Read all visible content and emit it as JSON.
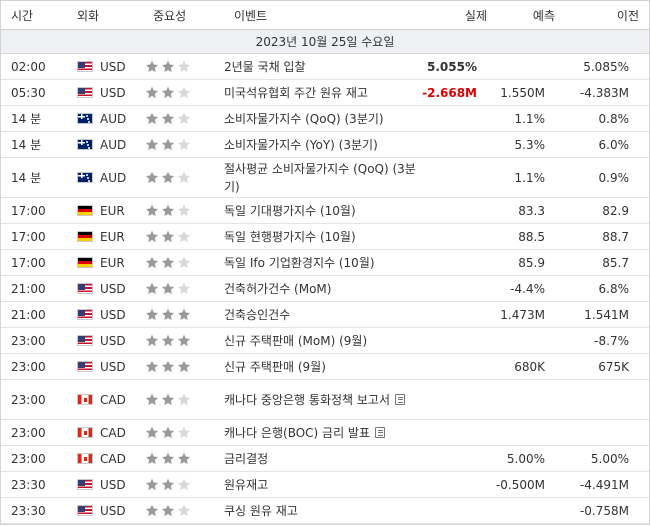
{
  "header": {
    "time": "시간",
    "currency": "외화",
    "importance": "중요성",
    "event": "이벤트",
    "actual": "실제",
    "forecast": "예측",
    "previous": "이전"
  },
  "date_label": "2023년 10월 25일 수요일",
  "colors": {
    "negative": "#e00000",
    "star_on": "#9a9a9a",
    "star_off": "#d9d9d9",
    "date_bg": "#eef0f3"
  },
  "rows": [
    {
      "time": "02:00",
      "flag": "us",
      "currency": "USD",
      "stars": 2,
      "event": "2년물 국채 입찰",
      "doc": false,
      "actual": "5.055%",
      "actual_color": "pos",
      "forecast": "",
      "previous": "5.085%",
      "prev_bold": false,
      "tall": false
    },
    {
      "time": "05:30",
      "flag": "us",
      "currency": "USD",
      "stars": 2,
      "event": "미국석유협회 주간 원유 재고",
      "doc": false,
      "actual": "-2.668M",
      "actual_color": "neg",
      "forecast": "1.550M",
      "previous": "-4.383M",
      "prev_bold": false,
      "tall": false
    },
    {
      "time": "14 분",
      "flag": "au",
      "currency": "AUD",
      "stars": 2,
      "event": "소비자물가지수 (QoQ) (3분기)",
      "doc": false,
      "actual": "",
      "actual_color": "pos",
      "forecast": "1.1%",
      "previous": "0.8%",
      "prev_bold": false,
      "tall": false
    },
    {
      "time": "14 분",
      "flag": "au",
      "currency": "AUD",
      "stars": 2,
      "event": "소비자물가지수 (YoY) (3분기)",
      "doc": false,
      "actual": "",
      "actual_color": "pos",
      "forecast": "5.3%",
      "previous": "6.0%",
      "prev_bold": false,
      "tall": false
    },
    {
      "time": "14 분",
      "flag": "au",
      "currency": "AUD",
      "stars": 2,
      "event": "절사평균 소비자물가지수 (QoQ) (3분기)",
      "doc": false,
      "actual": "",
      "actual_color": "pos",
      "forecast": "1.1%",
      "previous": "0.9%",
      "prev_bold": false,
      "tall": true
    },
    {
      "time": "17:00",
      "flag": "de",
      "currency": "EUR",
      "stars": 2,
      "event": "독일 기대평가지수 (10월)",
      "doc": false,
      "actual": "",
      "actual_color": "pos",
      "forecast": "83.3",
      "previous": "82.9",
      "prev_bold": false,
      "tall": false
    },
    {
      "time": "17:00",
      "flag": "de",
      "currency": "EUR",
      "stars": 2,
      "event": "독일 현행평가지수 (10월)",
      "doc": false,
      "actual": "",
      "actual_color": "pos",
      "forecast": "88.5",
      "previous": "88.7",
      "prev_bold": false,
      "tall": false
    },
    {
      "time": "17:00",
      "flag": "de",
      "currency": "EUR",
      "stars": 2,
      "event": "독일 Ifo 기업환경지수 (10월)",
      "doc": false,
      "actual": "",
      "actual_color": "pos",
      "forecast": "85.9",
      "previous": "85.7",
      "prev_bold": false,
      "tall": false
    },
    {
      "time": "21:00",
      "flag": "us",
      "currency": "USD",
      "stars": 2,
      "event": "건축허가건수 (MoM)",
      "doc": false,
      "actual": "",
      "actual_color": "pos",
      "forecast": "-4.4%",
      "previous": "6.8%",
      "prev_bold": false,
      "tall": false
    },
    {
      "time": "21:00",
      "flag": "us",
      "currency": "USD",
      "stars": 3,
      "event": "건축승인건수",
      "doc": false,
      "actual": "",
      "actual_color": "pos",
      "forecast": "1.473M",
      "previous": "1.541M",
      "prev_bold": false,
      "tall": false
    },
    {
      "time": "23:00",
      "flag": "us",
      "currency": "USD",
      "stars": 3,
      "event": "신규 주택판매 (MoM) (9월)",
      "doc": false,
      "actual": "",
      "actual_color": "pos",
      "forecast": "",
      "previous": "-8.7%",
      "prev_bold": false,
      "tall": false
    },
    {
      "time": "23:00",
      "flag": "us",
      "currency": "USD",
      "stars": 3,
      "event": "신규 주택판매 (9월)",
      "doc": false,
      "actual": "",
      "actual_color": "pos",
      "forecast": "680K",
      "previous": "675K",
      "prev_bold": false,
      "tall": false
    },
    {
      "time": "23:00",
      "flag": "ca",
      "currency": "CAD",
      "stars": 2,
      "event": "캐나다 중앙은행 통화정책 보고서",
      "doc": true,
      "actual": "",
      "actual_color": "pos",
      "forecast": "",
      "previous": "",
      "prev_bold": false,
      "tall": true
    },
    {
      "time": "23:00",
      "flag": "ca",
      "currency": "CAD",
      "stars": 2,
      "event": "캐나다 은행(BOC) 금리 발표",
      "doc": true,
      "actual": "",
      "actual_color": "pos",
      "forecast": "",
      "previous": "",
      "prev_bold": false,
      "tall": false
    },
    {
      "time": "23:00",
      "flag": "ca",
      "currency": "CAD",
      "stars": 3,
      "event": "금리결정",
      "doc": false,
      "actual": "",
      "actual_color": "pos",
      "forecast": "5.00%",
      "previous": "5.00%",
      "prev_bold": false,
      "tall": false
    },
    {
      "time": "23:30",
      "flag": "us",
      "currency": "USD",
      "stars": 2,
      "event": "원유재고",
      "doc": false,
      "actual": "",
      "actual_color": "pos",
      "forecast": "-0.500M",
      "previous": "-4.491M",
      "prev_bold": false,
      "tall": false
    },
    {
      "time": "23:30",
      "flag": "us",
      "currency": "USD",
      "stars": 2,
      "event": "쿠싱 원유 재고",
      "doc": false,
      "actual": "",
      "actual_color": "pos",
      "forecast": "",
      "previous": "-0.758M",
      "prev_bold": false,
      "tall": false
    }
  ]
}
